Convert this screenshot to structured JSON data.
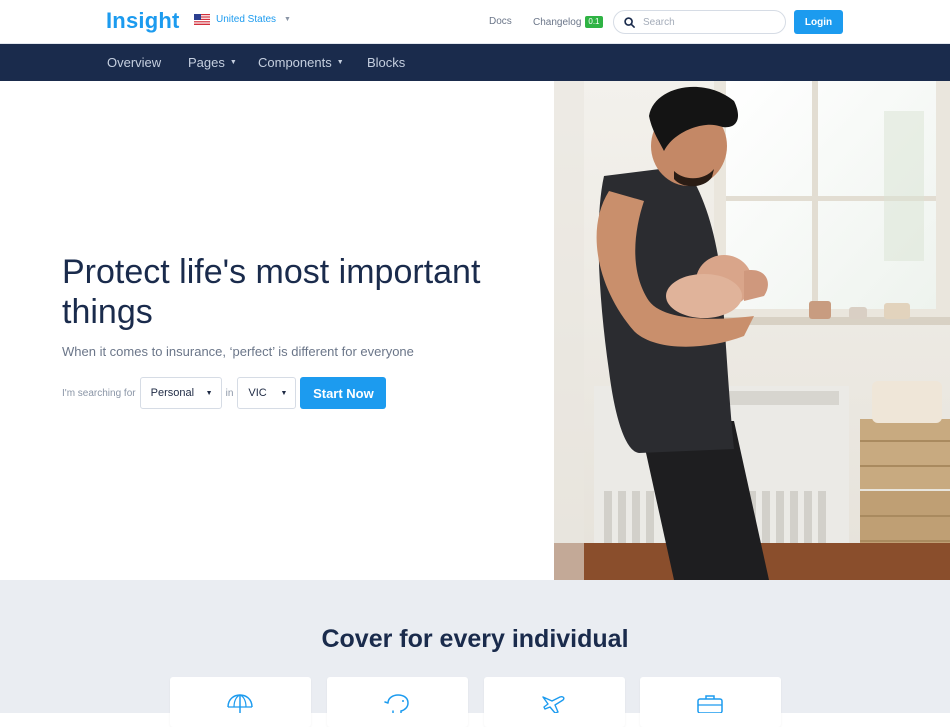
{
  "header": {
    "logo": "Insight",
    "country": "United States",
    "links": {
      "docs": "Docs",
      "changelog": "Changelog",
      "changelog_badge": "0.1"
    },
    "search": {
      "placeholder": "Search"
    },
    "login_label": "Login"
  },
  "nav": {
    "items": [
      {
        "label": "Overview",
        "has_dropdown": false
      },
      {
        "label": "Pages",
        "has_dropdown": true
      },
      {
        "label": "Components",
        "has_dropdown": true
      },
      {
        "label": "Blocks",
        "has_dropdown": false
      }
    ]
  },
  "hero": {
    "title": "Protect life's most important things",
    "subtitle": "When it comes to insurance, ‘perfect’ is different for everyone",
    "form": {
      "searching_label": "I'm searching for",
      "type_value": "Personal",
      "in_label": "in",
      "state_value": "VIC",
      "start_label": "Start Now"
    }
  },
  "cover": {
    "title": "Cover for every individual",
    "cards": [
      {
        "icon": "umbrella-icon"
      },
      {
        "icon": "piggy-bank-icon"
      },
      {
        "icon": "plane-icon"
      },
      {
        "icon": "briefcase-icon"
      }
    ]
  },
  "colors": {
    "brand": "#1c9bef",
    "navy": "#1a2b4c",
    "success": "#2fb344"
  }
}
